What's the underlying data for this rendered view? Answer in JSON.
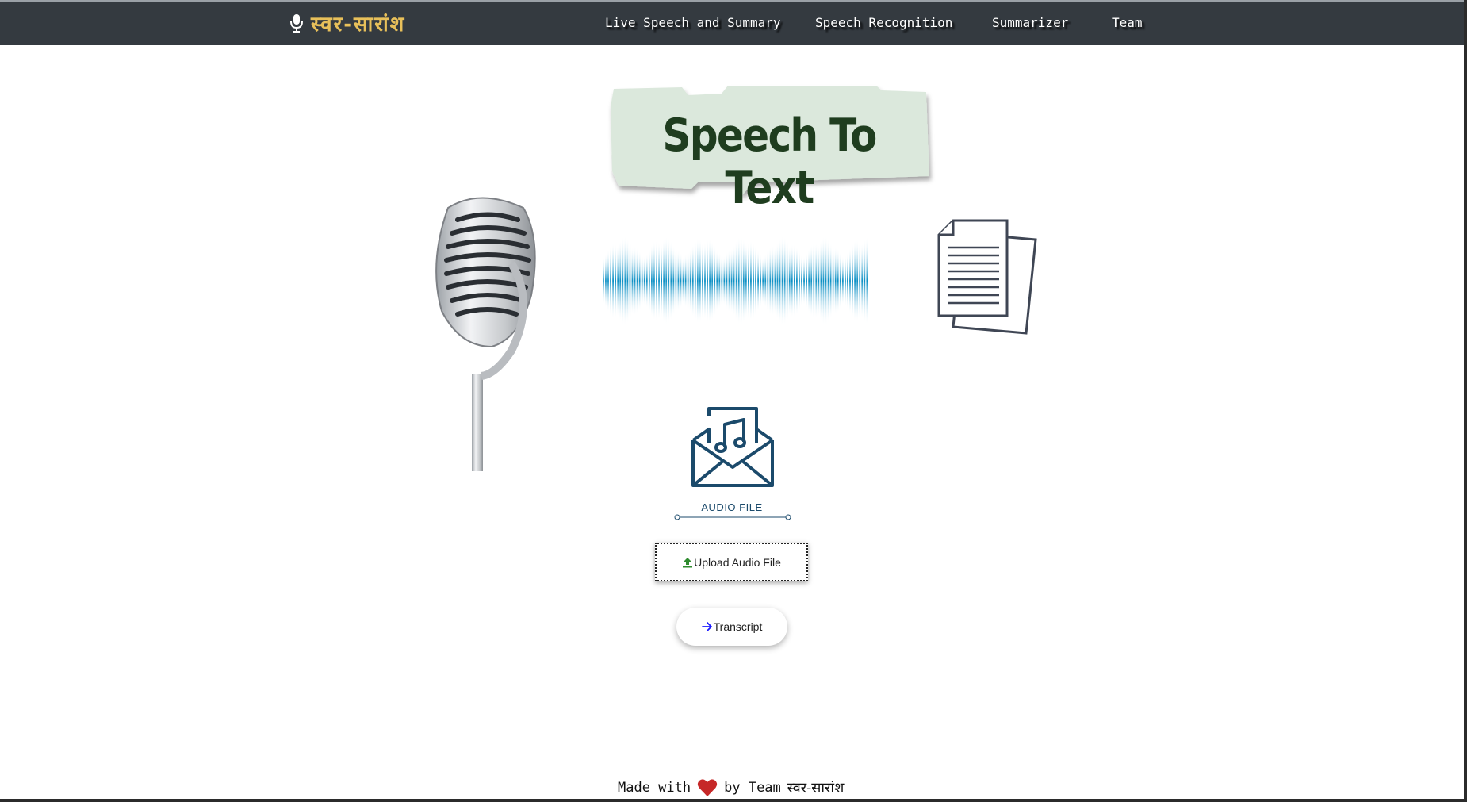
{
  "navbar": {
    "brand": "स्वर-सारांश",
    "links": [
      "Live Speech and Summary",
      "Speech Recognition",
      "Summarizer",
      "Team"
    ]
  },
  "hero": {
    "title": "Speech To Text"
  },
  "upload": {
    "label": "AUDIO FILE",
    "upload_button": "Upload Audio File",
    "transcript_button": "Transcript"
  },
  "footer": {
    "prefix": "Made with",
    "middle": "by Team",
    "brand": "स्वर-सारांश"
  },
  "colors": {
    "navbar_bg": "#343a40",
    "brand": "#e8c05a",
    "upload_icon": "#2e8b2e",
    "arrow_icon": "#1a1aff",
    "heart": "#c62828",
    "audio_icon": "#1b4a6b"
  },
  "icons": [
    "microphone-icon",
    "upload-icon",
    "arrow-right-icon",
    "heart-icon",
    "audio-envelope-icon"
  ]
}
